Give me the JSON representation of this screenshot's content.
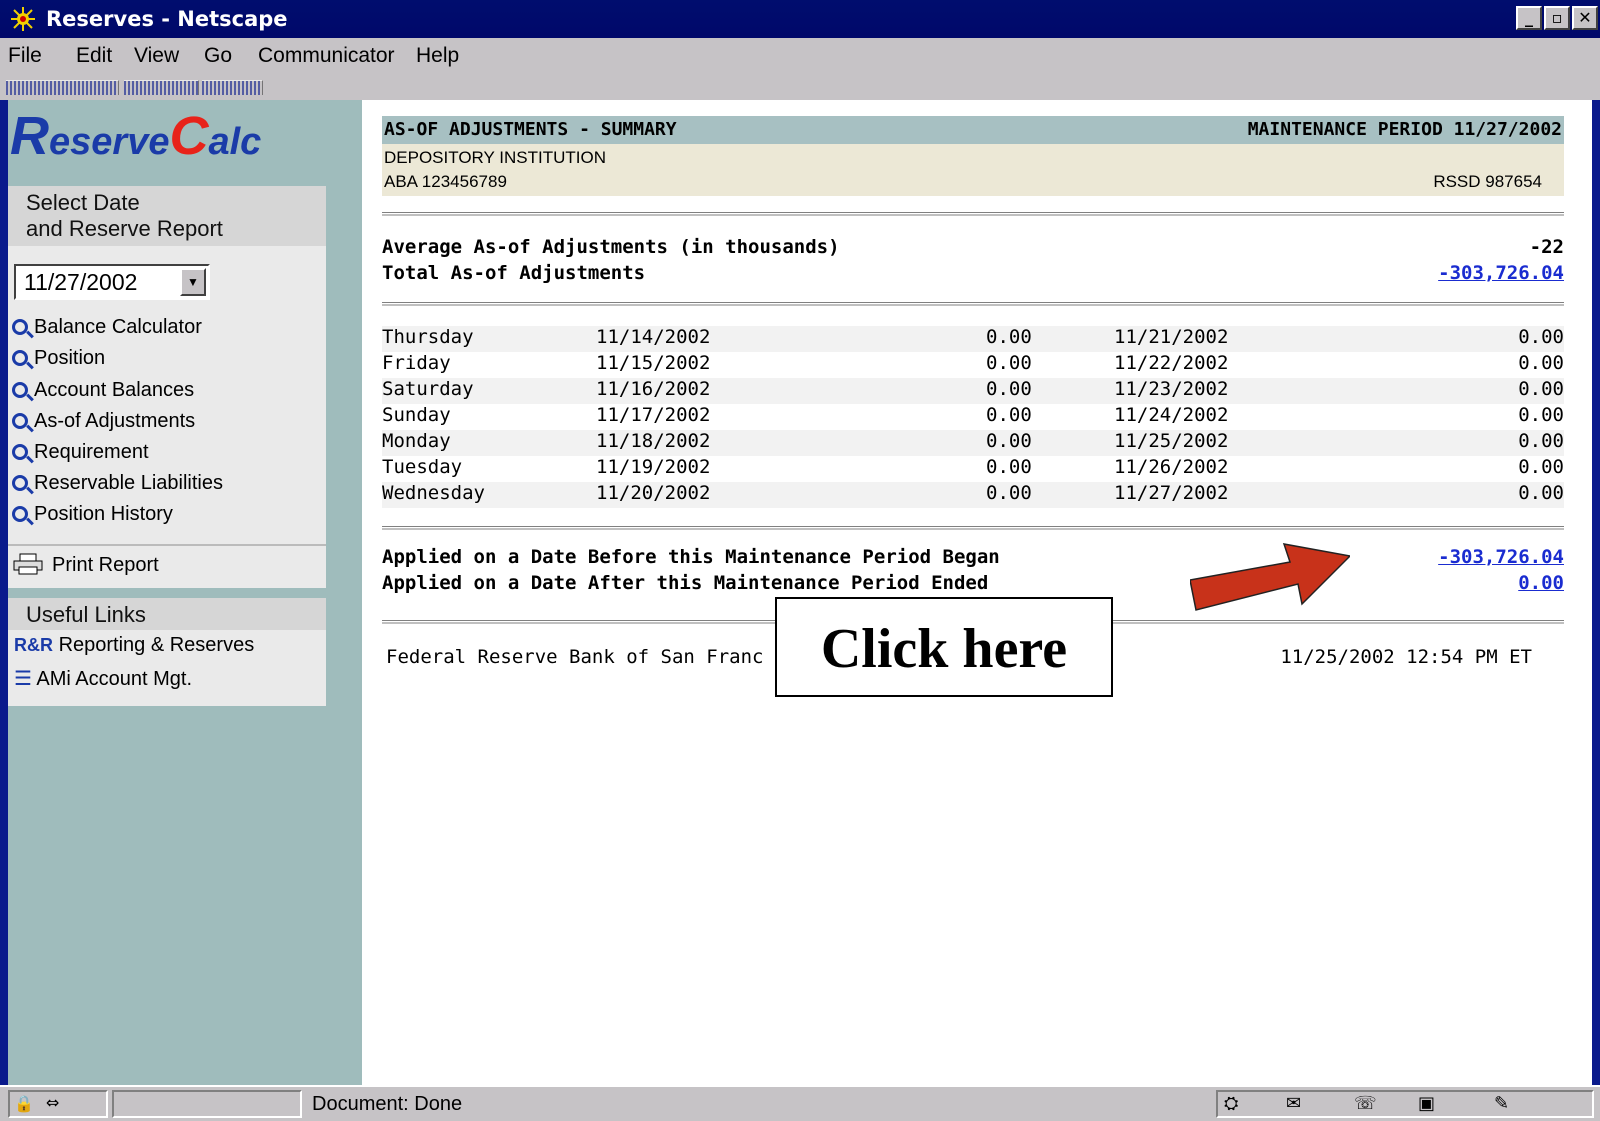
{
  "window": {
    "title": "Reserves - Netscape"
  },
  "menu": [
    "File",
    "Edit",
    "View",
    "Go",
    "Communicator",
    "Help"
  ],
  "left_nav": {
    "logo_r": "R",
    "logo_rest1": "eserve",
    "logo_c": "C",
    "logo_rest2": "alc",
    "select_heading_1": "Select Date",
    "select_heading_2": "and Reserve Report",
    "selected_date": "11/27/2002",
    "links": [
      "Balance Calculator",
      "Position",
      "Account Balances",
      "As-of Adjustments",
      "Requirement",
      "Reservable Liabilities",
      "Position History"
    ],
    "print_label": "Print Report",
    "useful_heading": "Useful Links",
    "rr_badge": "R&R",
    "rr_label": "Reporting & Reserves",
    "ami_label": "AMi Account Mgt."
  },
  "report": {
    "title": "AS-OF ADJUSTMENTS - SUMMARY",
    "period": "MAINTENANCE PERIOD 11/27/2002",
    "institution": "DEPOSITORY INSTITUTION",
    "aba": "ABA 123456789",
    "rssd": "RSSD 987654",
    "avg_label": "Average As-of Adjustments (in thousands)",
    "avg_value": "-22",
    "total_label": "Total As-of Adjustments",
    "total_value": "-303,726.04",
    "rows": [
      {
        "day": "Thursday",
        "date1": "11/14/2002",
        "val1": "0.00",
        "date2": "11/21/2002",
        "val2": "0.00"
      },
      {
        "day": "Friday",
        "date1": "11/15/2002",
        "val1": "0.00",
        "date2": "11/22/2002",
        "val2": "0.00"
      },
      {
        "day": "Saturday",
        "date1": "11/16/2002",
        "val1": "0.00",
        "date2": "11/23/2002",
        "val2": "0.00"
      },
      {
        "day": "Sunday",
        "date1": "11/17/2002",
        "val1": "0.00",
        "date2": "11/24/2002",
        "val2": "0.00"
      },
      {
        "day": "Monday",
        "date1": "11/18/2002",
        "val1": "0.00",
        "date2": "11/25/2002",
        "val2": "0.00"
      },
      {
        "day": "Tuesday",
        "date1": "11/19/2002",
        "val1": "0.00",
        "date2": "11/26/2002",
        "val2": "0.00"
      },
      {
        "day": "Wednesday",
        "date1": "11/20/2002",
        "val1": "0.00",
        "date2": "11/27/2002",
        "val2": "0.00"
      }
    ],
    "before_label": "Applied on a Date Before this Maintenance Period Began",
    "before_value": "-303,726.04",
    "after_label": "Applied on a Date After this Maintenance Period Ended",
    "after_value": "0.00",
    "footer_org": "Federal Reserve Bank of San Franc",
    "footer_time": "11/25/2002 12:54 PM ET"
  },
  "callout": {
    "text": "Click here",
    "arrow_color": "#c8321a"
  },
  "status": {
    "text": "Document: Done"
  },
  "colors": {
    "accent": "#0a1a8c",
    "link": "#1a2cd0",
    "header_bar": "#a7c0c2",
    "inst_bar": "#ece8d6",
    "logo_red": "#e8231a",
    "logo_blue": "#1a3ba8"
  }
}
